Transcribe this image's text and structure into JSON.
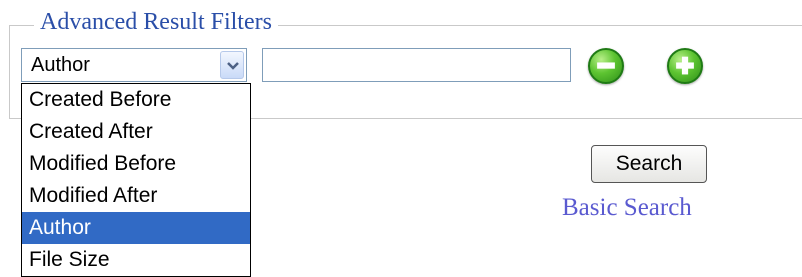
{
  "filters": {
    "legend": "Advanced Result Filters",
    "field_select": {
      "value": "Author",
      "options": [
        "Created Before",
        "Created After",
        "Modified Before",
        "Modified After",
        "Author",
        "File Size"
      ],
      "selected_index": 4
    },
    "value_input": {
      "value": ""
    },
    "remove_icon": "minus-circle-icon",
    "add_icon": "plus-circle-icon"
  },
  "actions": {
    "search_label": "Search",
    "basic_search_label": "Basic Search"
  }
}
